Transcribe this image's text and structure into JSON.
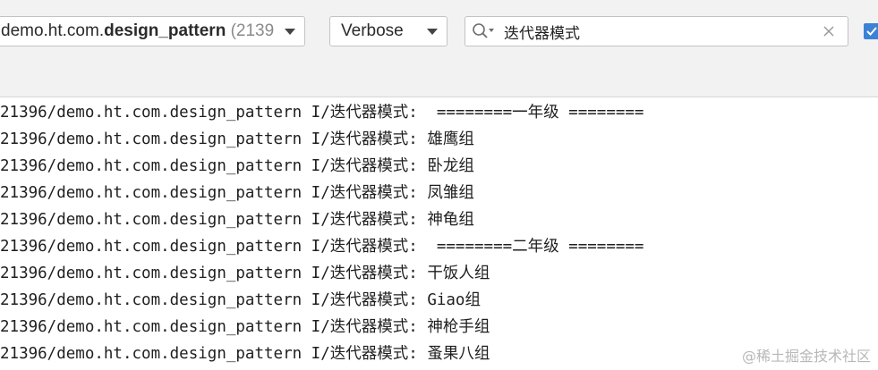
{
  "toolbar": {
    "process_prefix": "demo.ht.com.",
    "process_bold": "design_pattern",
    "process_suffix": " (2139",
    "log_level": "Verbose",
    "search_value": "迭代器模式",
    "search_placeholder": "",
    "filter_checked": true
  },
  "log_lines": [
    "21396/demo.ht.com.design_pattern I/迭代器模式:  ========一年级 ========",
    "21396/demo.ht.com.design_pattern I/迭代器模式: 雄鹰组",
    "21396/demo.ht.com.design_pattern I/迭代器模式: 卧龙组",
    "21396/demo.ht.com.design_pattern I/迭代器模式: 凤雏组",
    "21396/demo.ht.com.design_pattern I/迭代器模式: 神龟组",
    "21396/demo.ht.com.design_pattern I/迭代器模式:  ========二年级 ========",
    "21396/demo.ht.com.design_pattern I/迭代器模式: 干饭人组",
    "21396/demo.ht.com.design_pattern I/迭代器模式: Giao组",
    "21396/demo.ht.com.design_pattern I/迭代器模式: 神枪手组",
    "21396/demo.ht.com.design_pattern I/迭代器模式: 蚤果八组"
  ],
  "watermark": "@稀土掘金技术社区",
  "icons": {
    "search": "search-icon",
    "clear": "close-icon",
    "dropdown": "chevron-down-icon",
    "checkbox": "check-icon"
  },
  "colors": {
    "toolbar_bg": "#f2f2f2",
    "checkbox_accent": "#3b82d6",
    "log_text": "#1f1f1f"
  }
}
